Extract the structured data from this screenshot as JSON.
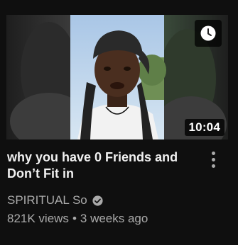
{
  "video": {
    "duration": "10:04",
    "title": "why you have 0 Friends and Don’t Fit in",
    "channel": "SPIRITUAL So",
    "views": "821K views",
    "separator": "•",
    "age": "3 weeks ago"
  },
  "icons": {
    "watch_later": "clock-icon",
    "menu": "more-vertical-icon",
    "verified": "verified-check-icon"
  },
  "colors": {
    "background": "#0f0f0f",
    "title": "#f1f1f1",
    "secondary": "#aaaaaa",
    "duration_badge_bg": "#000000"
  }
}
